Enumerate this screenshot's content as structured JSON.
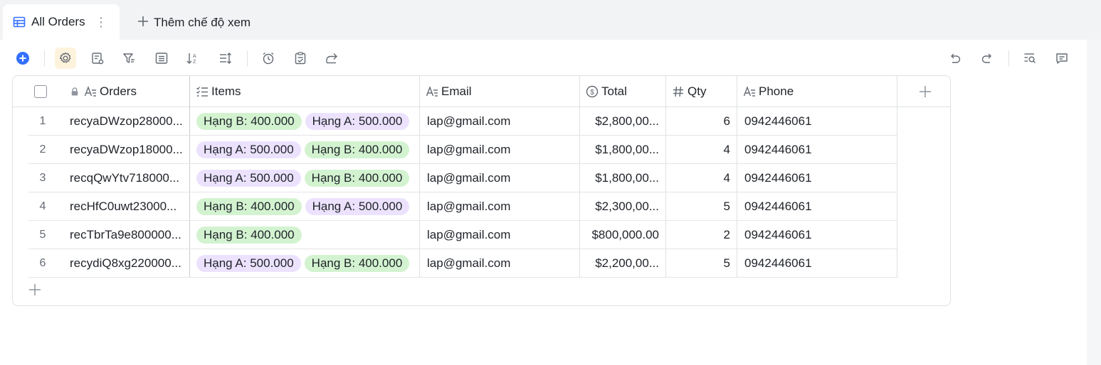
{
  "tabs": {
    "active_label": "All Orders",
    "more_label": "⋮",
    "add_view_label": "Thêm chế độ xem"
  },
  "colors": {
    "accent": "#3370ff",
    "tag_hang_b": "#d3f3d0",
    "tag_hang_a": "#ece2fe",
    "active_tool_bg": "#fdf3dd"
  },
  "toolbar": {
    "left_icons": [
      "add-record-icon",
      "settings-icon",
      "field-config-icon",
      "filter-icon",
      "group-icon",
      "sort-icon",
      "row-height-icon",
      "automation-clock-icon",
      "form-icon",
      "share-icon"
    ],
    "right_icons": [
      "undo-icon",
      "redo-icon",
      "search-icon",
      "comment-icon"
    ]
  },
  "table": {
    "columns": [
      {
        "label": "Orders",
        "icon": "text-field-icon",
        "locked": true
      },
      {
        "label": "Items",
        "icon": "multi-select-icon"
      },
      {
        "label": "Email",
        "icon": "text-field-icon"
      },
      {
        "label": "Total",
        "icon": "currency-icon"
      },
      {
        "label": "Qty",
        "icon": "number-icon"
      },
      {
        "label": "Phone",
        "icon": "text-field-icon"
      }
    ],
    "rows": [
      {
        "index": "1",
        "order": "recyaDWzop28000...",
        "items": [
          {
            "label": "Hạng B: 400.000",
            "kind": "b"
          },
          {
            "label": "Hạng A: 500.000",
            "kind": "a"
          }
        ],
        "email": "lap@gmail.com",
        "total": "$2,800,00...",
        "qty": "6",
        "phone": "0942446061"
      },
      {
        "index": "2",
        "order": "recyaDWzop18000...",
        "items": [
          {
            "label": "Hạng A: 500.000",
            "kind": "a"
          },
          {
            "label": "Hạng B: 400.000",
            "kind": "b"
          }
        ],
        "email": "lap@gmail.com",
        "total": "$1,800,00...",
        "qty": "4",
        "phone": "0942446061"
      },
      {
        "index": "3",
        "order": "recqQwYtv718000...",
        "items": [
          {
            "label": "Hạng A: 500.000",
            "kind": "a"
          },
          {
            "label": "Hạng B: 400.000",
            "kind": "b"
          }
        ],
        "email": "lap@gmail.com",
        "total": "$1,800,00...",
        "qty": "4",
        "phone": "0942446061"
      },
      {
        "index": "4",
        "order": "recHfC0uwt23000...",
        "items": [
          {
            "label": "Hạng B: 400.000",
            "kind": "b"
          },
          {
            "label": "Hạng A: 500.000",
            "kind": "a"
          }
        ],
        "email": "lap@gmail.com",
        "total": "$2,300,00...",
        "qty": "5",
        "phone": "0942446061"
      },
      {
        "index": "5",
        "order": "recTbrTa9e800000...",
        "items": [
          {
            "label": "Hạng B: 400.000",
            "kind": "b"
          }
        ],
        "email": "lap@gmail.com",
        "total": "$800,000.00",
        "qty": "2",
        "phone": "0942446061"
      },
      {
        "index": "6",
        "order": "recydiQ8xg220000...",
        "items": [
          {
            "label": "Hạng A: 500.000",
            "kind": "a"
          },
          {
            "label": "Hạng B: 400.000",
            "kind": "b"
          }
        ],
        "email": "lap@gmail.com",
        "total": "$2,200,00...",
        "qty": "5",
        "phone": "0942446061"
      }
    ]
  }
}
